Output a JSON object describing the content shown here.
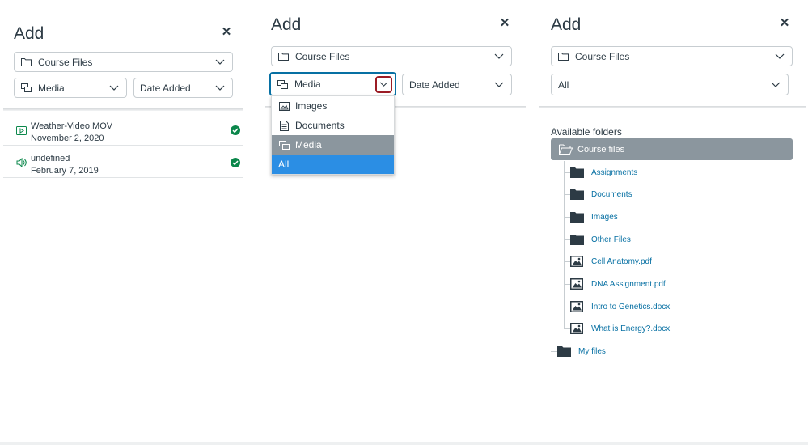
{
  "panel1": {
    "title": "Add",
    "location_select": "Course Files",
    "type_select": "Media",
    "sort_select": "Date Added",
    "files": [
      {
        "name": "Weather-Video.MOV",
        "date": "November 2, 2020",
        "icon": "video-icon"
      },
      {
        "name": "undefined",
        "date": "February 7, 2019",
        "icon": "audio-icon"
      }
    ]
  },
  "panel2": {
    "title": "Add",
    "location_select": "Course Files",
    "type_select": "Media",
    "sort_select": "Date Added",
    "menu_items": [
      {
        "label": "Images",
        "icon": "image-icon"
      },
      {
        "label": "Documents",
        "icon": "document-icon"
      },
      {
        "label": "Media",
        "icon": "media-icon",
        "state": "selected"
      },
      {
        "label": "All",
        "state": "highlighted"
      }
    ]
  },
  "panel3": {
    "title": "Add",
    "location_select": "Course Files",
    "type_select": "All",
    "section_label": "Available folders",
    "root_folder": "Course files",
    "children": [
      {
        "label": "Assignments",
        "icon": "folder-icon"
      },
      {
        "label": "Documents",
        "icon": "folder-icon"
      },
      {
        "label": "Images",
        "icon": "folder-icon"
      },
      {
        "label": "Other Files",
        "icon": "folder-icon"
      },
      {
        "label": "Cell Anatomy.pdf",
        "icon": "image-file-icon"
      },
      {
        "label": "DNA Assignment.pdf",
        "icon": "image-file-icon"
      },
      {
        "label": "Intro to Genetics.docx",
        "icon": "image-file-icon"
      },
      {
        "label": "What is Energy?.docx",
        "icon": "image-file-icon"
      }
    ],
    "sibling_folder": "My files"
  },
  "colors": {
    "text": "#2d3b45",
    "link": "#0770a3",
    "success": "#0b874b",
    "selected_bg": "#8b969e",
    "highlight_bg": "#2b8ee4",
    "focus_ring": "#9b1c25"
  }
}
